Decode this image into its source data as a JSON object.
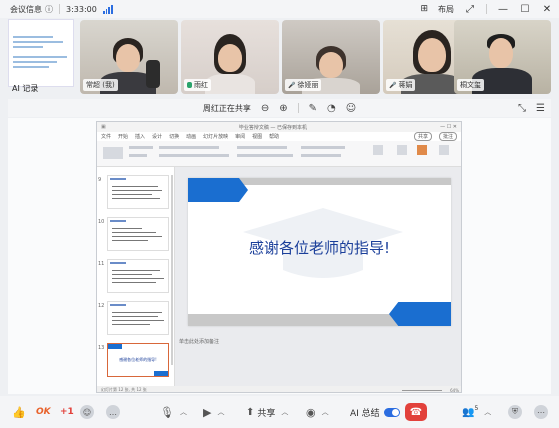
{
  "topbar": {
    "meeting_info": "会议信息",
    "time": "3:33:00",
    "layout": "布局",
    "icons": [
      "info-icon",
      "signal-icon",
      "layout-icon",
      "fullscreen-icon",
      "minimize-icon",
      "maximize-icon",
      "close-icon"
    ]
  },
  "strip": {
    "ai_label": "AI 记录",
    "participants": [
      {
        "name": "常超 (我)",
        "mic": "on"
      },
      {
        "name": "雨红",
        "mic": "on"
      },
      {
        "name": "徐娅丽",
        "mic": "off"
      },
      {
        "name": "蒋娟",
        "mic": "off"
      },
      {
        "name": "桐文玺",
        "mic": "on"
      }
    ]
  },
  "sharebar": {
    "label": "周红正在共享"
  },
  "ppt": {
    "window_title": "毕业答辩文稿 — 已保存到本机",
    "menu": [
      "文件",
      "开始",
      "插入",
      "设计",
      "切换",
      "动画",
      "幻灯片放映",
      "审阅",
      "视图",
      "帮助"
    ],
    "share_btn": "共享",
    "comment_btn": "批注",
    "slide_numbers": [
      "9",
      "10",
      "11",
      "12"
    ],
    "selected_slide_text": "感谢各位老师的指导!",
    "slide_title": "感谢各位老师的指导!",
    "notes_placeholder": "单击此处添加备注",
    "status_left": "幻灯片第 12 张, 共 12 张",
    "status_zoom": "64%"
  },
  "toolbar": {
    "reactions": [
      "👍",
      "OK",
      "+1"
    ],
    "share_label": "共享",
    "ai_label": "AI 总结",
    "participants_count": "5",
    "colors": {
      "end": "#e2413b",
      "accent": "#2b6de0"
    }
  }
}
